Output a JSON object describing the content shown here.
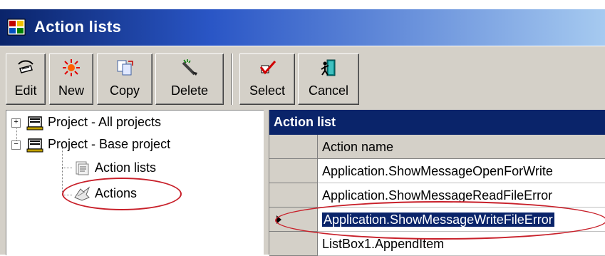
{
  "window": {
    "title": "Action lists"
  },
  "toolbar": {
    "buttons": [
      {
        "label": "Edit",
        "icon": "edit-icon"
      },
      {
        "label": "New",
        "icon": "new-icon"
      },
      {
        "label": "Copy",
        "icon": "copy-icon"
      },
      {
        "label": "Delete",
        "icon": "delete-icon"
      },
      {
        "label": "Select",
        "icon": "select-icon"
      },
      {
        "label": "Cancel",
        "icon": "cancel-icon"
      }
    ]
  },
  "tree": {
    "items": [
      {
        "label": "Project - All projects",
        "expander": "+"
      },
      {
        "label": "Project - Base project",
        "expander": "−"
      },
      {
        "label": "Action lists"
      },
      {
        "label": "Actions"
      }
    ]
  },
  "grid": {
    "caption": "Action list",
    "column_header": "Action name",
    "rows": [
      "Application.ShowMessageOpenForWrite",
      "Application.ShowMessageReadFileError",
      "Application.ShowMessageWriteFileError",
      "ListBox1.AppendItem"
    ]
  },
  "colors": {
    "highlight": "#0a246a",
    "annotation": "#c8202a"
  }
}
